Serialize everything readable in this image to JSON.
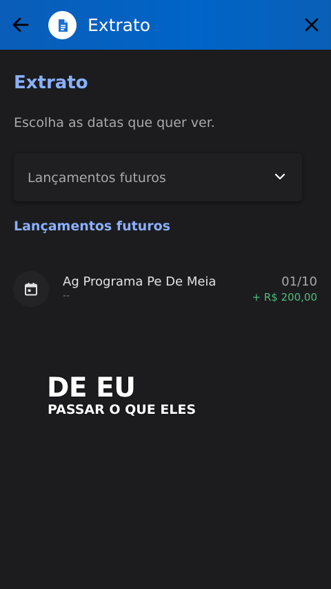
{
  "header": {
    "title": "Extrato",
    "back_icon": "arrow-left-icon",
    "app_icon": "document-icon",
    "close_icon": "close-icon",
    "background": "#0064c8"
  },
  "main": {
    "title": "Extrato",
    "subtitle": "Escolha as datas que quer ver.",
    "period_select": {
      "value": "Lançamentos futuros",
      "icon": "chevron-down-icon"
    },
    "section_heading": "Lançamentos futuros",
    "entries": [
      {
        "title": "Ag Programa Pe De Meia",
        "subtitle": "--",
        "date": "01/10",
        "amount": "+ R$ 200,00",
        "icon": "calendar-icon"
      }
    ]
  },
  "overlay_caption": {
    "line1": "DE EU",
    "line2": "PASSAR O QUE ELES"
  },
  "colors": {
    "accent": "#8ab0ff",
    "positive": "#4fbf7e",
    "background": "#1c1c1e"
  }
}
